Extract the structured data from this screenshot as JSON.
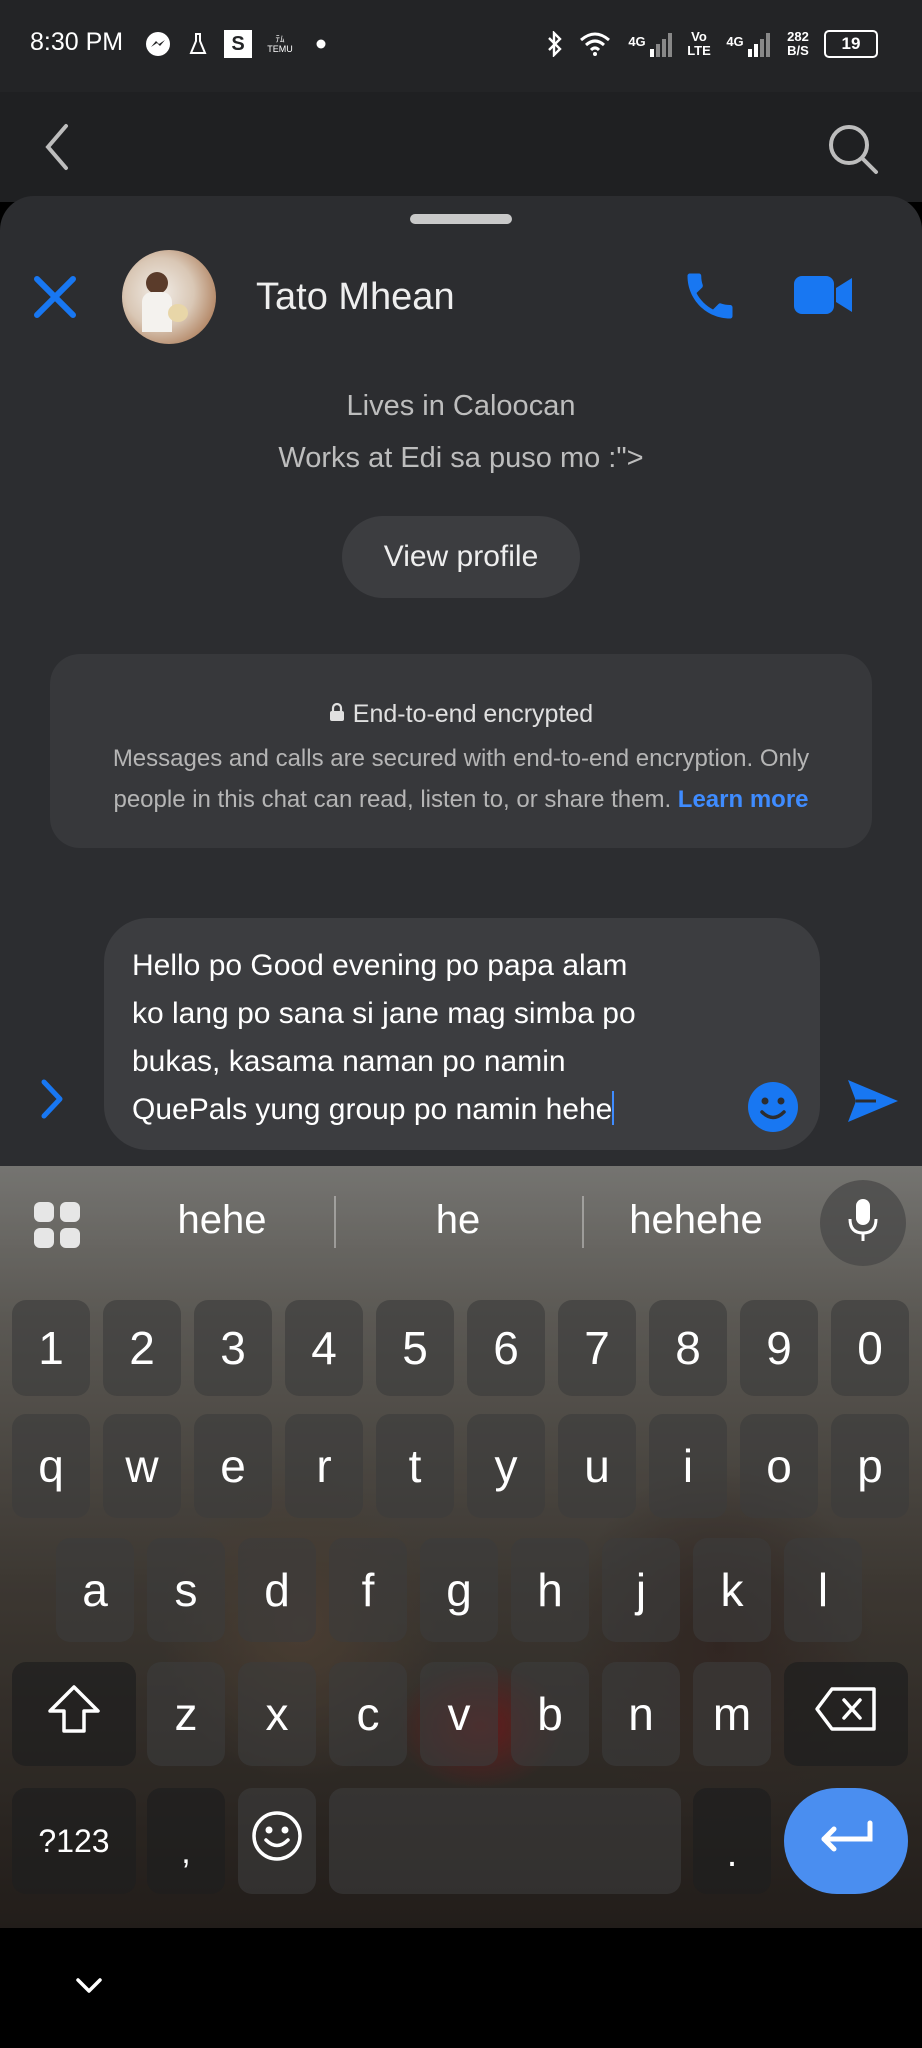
{
  "status_bar": {
    "time": "8:30 PM",
    "app_s": "S",
    "temu_line1": "ﾃﾑ",
    "temu_line2": "TEMU",
    "net1": "4G",
    "volte_top": "Vo",
    "volte_bottom": "LTE",
    "net2": "4G",
    "speed_top": "282",
    "speed_bottom": "B/S",
    "battery": "19"
  },
  "contact": {
    "name": "Tato Mhean",
    "lives": "Lives in Caloocan",
    "works": "Works at Edi sa puso mo :\">",
    "view_profile": "View profile"
  },
  "encryption": {
    "title": "End-to-end encrypted",
    "body": "Messages and calls are secured with end-to-end encryption. Only people in this chat can read, listen to, or share them.",
    "link": "Learn more"
  },
  "composer": {
    "text": "Hello po Good evening po papa alam\nko lang po sana si jane mag simba po\nbukas, kasama naman po namin\nQuePals yung group po namin hehe"
  },
  "keyboard": {
    "suggestions": [
      "hehe",
      "he",
      "hehehe"
    ],
    "row_numbers": [
      "1",
      "2",
      "3",
      "4",
      "5",
      "6",
      "7",
      "8",
      "9",
      "0"
    ],
    "row1": [
      "q",
      "w",
      "e",
      "r",
      "t",
      "y",
      "u",
      "i",
      "o",
      "p"
    ],
    "row2": [
      "a",
      "s",
      "d",
      "f",
      "g",
      "h",
      "j",
      "k",
      "l"
    ],
    "row3": [
      "z",
      "x",
      "c",
      "v",
      "b",
      "n",
      "m"
    ],
    "symbols_key": "?123",
    "comma_key": ",",
    "period_key": "."
  },
  "colors": {
    "accent_blue": "#1877f2",
    "link_blue": "#3f8cff",
    "sheet_bg": "#2c2d30"
  }
}
